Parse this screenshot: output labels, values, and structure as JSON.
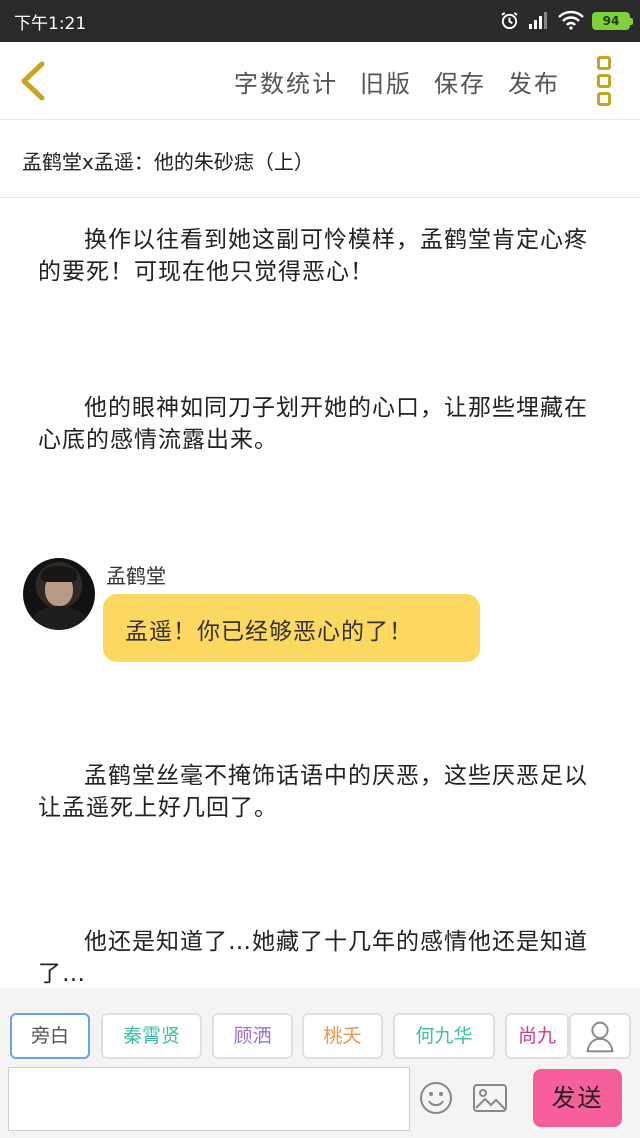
{
  "status_bar": {
    "time": "下午1:21",
    "battery": "94"
  },
  "toolbar": {
    "word_count": "字数统计",
    "old_version": "旧版",
    "save": "保存",
    "publish": "发布"
  },
  "title": "孟鹤堂x孟遥：他的朱砂痣（上）",
  "content": {
    "para1": "换作以往看到她这副可怜模样，孟鹤堂肯定心疼的要死！可现在他只觉得恶心！",
    "para2": "他的眼神如同刀子划开她的心口，让那些埋藏在心底的感情流露出来。",
    "dialogue": {
      "speaker": "孟鹤堂",
      "text": "孟遥！你已经够恶心的了！"
    },
    "para3": "孟鹤堂丝毫不掩饰话语中的厌恶，这些厌恶足以让孟遥死上好几回了。",
    "para4": "他还是知道了…她藏了十几年的感情他还是知道了…"
  },
  "characters": [
    {
      "label": "旁白",
      "color": "#555555"
    },
    {
      "label": "秦霄贤",
      "color": "#3bbfa8"
    },
    {
      "label": "顾洒",
      "color": "#9b6fd6"
    },
    {
      "label": "桃夭",
      "color": "#f0944a"
    },
    {
      "label": "何九华",
      "color": "#3bbfa8"
    },
    {
      "label": "尚九",
      "color": "#d13c8a"
    }
  ],
  "input": {
    "placeholder": "",
    "send_label": "发送"
  },
  "colors": {
    "accent_yellow": "#fcd860",
    "send_pink": "#f75f9a",
    "back_icon": "#c9a420"
  }
}
